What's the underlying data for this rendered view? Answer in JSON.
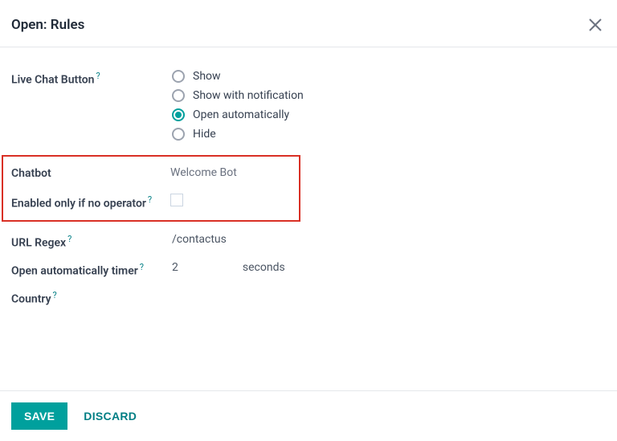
{
  "header": {
    "title": "Open: Rules"
  },
  "fields": {
    "live_chat_button": {
      "label": "Live Chat Button",
      "help": "?",
      "options": [
        {
          "label": "Show",
          "checked": false
        },
        {
          "label": "Show with notification",
          "checked": false
        },
        {
          "label": "Open automatically",
          "checked": true
        },
        {
          "label": "Hide",
          "checked": false
        }
      ]
    },
    "chatbot": {
      "label": "Chatbot",
      "value": "Welcome Bot"
    },
    "enabled_only": {
      "label": "Enabled only if no operator",
      "help": "?",
      "checked": false
    },
    "url_regex": {
      "label": "URL Regex",
      "help": "?",
      "value": "/contactus"
    },
    "auto_timer": {
      "label": "Open automatically timer",
      "help": "?",
      "value": "2",
      "unit": "seconds"
    },
    "country": {
      "label": "Country",
      "help": "?"
    }
  },
  "footer": {
    "save": "SAVE",
    "discard": "DISCARD"
  }
}
